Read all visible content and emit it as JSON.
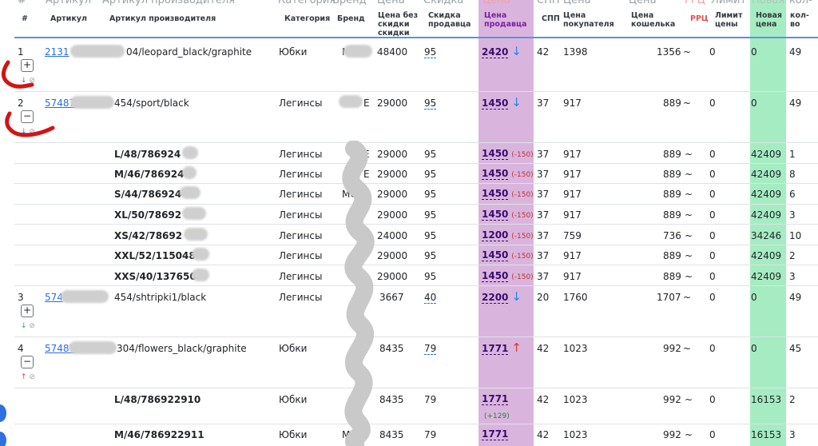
{
  "ghost_headers": [
    "#",
    "Артикул",
    "Артикул производителя",
    "Категория",
    "Бренд",
    "Цена",
    "Скидка",
    "Цена",
    "СПП",
    "Цена",
    "Цена",
    "РРЦ",
    "Лимит",
    "Новая",
    "кол-"
  ],
  "headers": {
    "num": "#",
    "article": "Артикул",
    "maker_article": "Артикул производителя",
    "category": "Категория",
    "brand": "Бренд",
    "price_no_discount": "Цена без скидки скидки",
    "seller_discount": "Скидка продавца",
    "seller_price": "Цена продавца",
    "spp": "СПП",
    "buyer_price": "Цена покупателя",
    "wallet_price": "Цена кошелька",
    "rrc": "РРЦ",
    "price_limit": "Лимит цены",
    "new_price": "Новая цена",
    "qty": "кол-во"
  },
  "main_rows": [
    {
      "num": "1",
      "article": "2131",
      "maker_article": "04/leopard_black/graphite",
      "category": "Юбки",
      "brand": "M",
      "price": "48400",
      "discount": "95",
      "seller_price": "2420",
      "trend": "↓",
      "spp": "42",
      "buyer_price": "1398",
      "wallet": "1356",
      "tilde": "~",
      "limit": "0",
      "new_price": "0",
      "qty": "49",
      "toggle": "+"
    },
    {
      "num": "2",
      "article": "57487",
      "maker_article": "454/sport/black",
      "category": "Легинсы",
      "brand": "E",
      "price": "29000",
      "discount": "95",
      "seller_price": "1450",
      "trend": "↓",
      "spp": "37",
      "buyer_price": "917",
      "wallet": "889",
      "tilde": "~",
      "limit": "0",
      "new_price": "0",
      "qty": "49",
      "toggle": "−"
    },
    {
      "num": "3",
      "article": "574",
      "maker_article": "454/shtripki1/black",
      "category": "Легинсы",
      "brand": "",
      "price": "3667",
      "discount": "40",
      "seller_price": "2200",
      "trend": "↓",
      "spp": "20",
      "buyer_price": "1760",
      "wallet": "1707",
      "tilde": "~",
      "limit": "0",
      "new_price": "0",
      "qty": "49",
      "toggle": "+"
    },
    {
      "num": "4",
      "article": "57487",
      "maker_article": "304/flowers_black/graphite",
      "category": "Юбки",
      "brand": "",
      "price": "8435",
      "discount": "79",
      "seller_price": "1771",
      "trend": "↑",
      "spp": "42",
      "buyer_price": "1023",
      "wallet": "992",
      "tilde": "~",
      "limit": "0",
      "new_price": "0",
      "qty": "45",
      "toggle": "−"
    }
  ],
  "size_rows_group2": [
    {
      "size": "L/48/786924",
      "category": "Легинсы",
      "brand": "E",
      "price": "29000",
      "discount": "95",
      "seller_price": "1450",
      "delta": "(-150)",
      "spp": "37",
      "buyer_price": "917",
      "wallet": "889",
      "tilde": "~",
      "limit": "0",
      "new_price": "42409",
      "qty": "1"
    },
    {
      "size": "M/46/786924",
      "category": "Легинсы",
      "brand": "E",
      "price": "29000",
      "discount": "95",
      "seller_price": "1450",
      "delta": "(-150)",
      "spp": "37",
      "buyer_price": "917",
      "wallet": "889",
      "tilde": "~",
      "limit": "0",
      "new_price": "42409",
      "qty": "8"
    },
    {
      "size": "S/44/786924",
      "category": "Легинсы",
      "brand": "MO",
      "price": "29000",
      "discount": "95",
      "seller_price": "1450",
      "delta": "(-150)",
      "spp": "37",
      "buyer_price": "917",
      "wallet": "889",
      "tilde": "~",
      "limit": "0",
      "new_price": "42409",
      "qty": "6"
    },
    {
      "size": "XL/50/78692",
      "category": "Легинсы",
      "brand": "",
      "price": "29000",
      "discount": "95",
      "seller_price": "1450",
      "delta": "(-150)",
      "spp": "37",
      "buyer_price": "917",
      "wallet": "889",
      "tilde": "~",
      "limit": "0",
      "new_price": "42409",
      "qty": "3"
    },
    {
      "size": "XS/42/78692",
      "category": "Легинсы",
      "brand": "",
      "price": "24000",
      "discount": "95",
      "seller_price": "1200",
      "delta": "(-150)",
      "spp": "37",
      "buyer_price": "759",
      "wallet": "736",
      "tilde": "~",
      "limit": "0",
      "new_price": "34246",
      "qty": "10"
    },
    {
      "size": "XXL/52/115048",
      "category": "Легинсы",
      "brand": "",
      "price": "29000",
      "discount": "95",
      "seller_price": "1450",
      "delta": "(-150)",
      "spp": "37",
      "buyer_price": "917",
      "wallet": "889",
      "tilde": "~",
      "limit": "0",
      "new_price": "42409",
      "qty": "2"
    },
    {
      "size": "XXS/40/137650",
      "category": "Легинсы",
      "brand": "",
      "price": "29000",
      "discount": "95",
      "seller_price": "1450",
      "delta": "(-150)",
      "spp": "37",
      "buyer_price": "917",
      "wallet": "889",
      "tilde": "~",
      "limit": "0",
      "new_price": "42409",
      "qty": "3"
    }
  ],
  "size_rows_group4": [
    {
      "size": "L/48/786922910",
      "category": "Юбки",
      "brand": "",
      "price": "8435",
      "discount": "79",
      "seller_price": "1771",
      "delta": "(+129)",
      "spp": "42",
      "buyer_price": "1023",
      "wallet": "992",
      "tilde": "~",
      "limit": "0",
      "new_price": "16153",
      "qty": "2"
    },
    {
      "size": "M/46/786922911",
      "category": "Юбки",
      "brand": "MO",
      "price": "8435",
      "discount": "79",
      "seller_price": "1771",
      "delta": "",
      "spp": "42",
      "buyer_price": "1023",
      "wallet": "992",
      "tilde": "~",
      "limit": "0",
      "new_price": "16153",
      "qty": "3"
    }
  ],
  "mini_icons": {
    "down": "↓",
    "up": "↑",
    "ban": "⊘"
  },
  "colors": {
    "price_column": "#d9b5dd",
    "new_price_column": "#a5ecc2",
    "link": "#2a6fdb",
    "annotation": "#d01515"
  }
}
